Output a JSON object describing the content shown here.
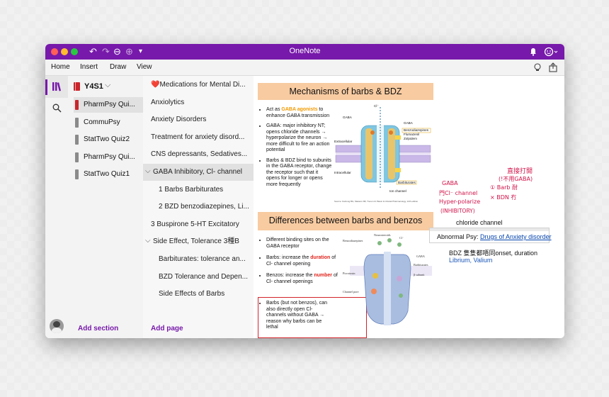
{
  "app": {
    "title": "OneNote"
  },
  "toolbar": {
    "undo": "↶",
    "redo": "↷",
    "back": "⊖",
    "forward": "⊕",
    "more": "▾"
  },
  "menu": {
    "home": "Home",
    "insert": "Insert",
    "draw": "Draw",
    "view": "View"
  },
  "notebook": {
    "name": "Y4S1",
    "chevron": "⌵"
  },
  "sections": [
    {
      "label": "PharmPsy Qui...",
      "color": "#c9252c",
      "selected": true
    },
    {
      "label": "CommuPsy",
      "color": "#8a8a8a"
    },
    {
      "label": "StatTwo Quiz2",
      "color": "#8a8a8a"
    },
    {
      "label": "PharmPsy Qui...",
      "color": "#8a8a8a"
    },
    {
      "label": "StatTwo Quiz1",
      "color": "#8a8a8a"
    }
  ],
  "add_section": "Add section",
  "add_page": "Add page",
  "pages": [
    {
      "label": "❤️Medications for Mental Di...",
      "indent": 0
    },
    {
      "label": "Anxiolytics",
      "indent": 0
    },
    {
      "label": "Anxiety Disorders",
      "indent": 0
    },
    {
      "label": "Treatment for anxiety disord...",
      "indent": 0
    },
    {
      "label": "CNS depressants, Sedatives...",
      "indent": 0
    },
    {
      "label": "GABA Inhibitory, Cl- channel",
      "indent": 0,
      "chevron": "⌵",
      "selected": true
    },
    {
      "label": "1 Barbs Barbiturates",
      "indent": 1
    },
    {
      "label": "2 BZD benzodiazepines, Li...",
      "indent": 1
    },
    {
      "label": "3 Buspirone 5-HT Excitatory",
      "indent": 0
    },
    {
      "label": "Side Effect, Tolerance 3種B",
      "indent": 0,
      "chevron": "⌵"
    },
    {
      "label": "Barbiturates: tolerance an...",
      "indent": 1
    },
    {
      "label": "BZD Tolerance and Depen...",
      "indent": 1
    },
    {
      "label": "Side Effects of Barbs",
      "indent": 1
    }
  ],
  "slide1": {
    "title": "Mechanisms of barbs & BDZ",
    "b1_pre": "Act as ",
    "b1_hl": "GABA agonists",
    "b1_post": " to enhance GABA transmission",
    "b2": "GABA: major inhibitory NT; opens chloride channels → hyperpolarize the neuron → more difficult to fire an action potential",
    "b3": "Barbs & BDZ bind to subunits in the GABA receptor, change the receptor such that it opens for longer or opens more frequently",
    "diagram": {
      "gaba": "GABA",
      "cl": "Cl⁻",
      "gaba2": "GABA",
      "benzo": "Benzodiazepines",
      "flumazenil": "Flumazenil",
      "zolpidem": "Zolpidem",
      "extracellular": "Extracellular",
      "intracellular": "Intracellular",
      "barbiturates": "Barbiturates",
      "ion_channel": "Ion channel",
      "source": "Source: Katzung BG, Masters SB, Trevor AJ: Basic & Clinical Pharmacology, 12th edition"
    }
  },
  "slide2": {
    "title": "Differences between barbs and benzos",
    "b1": "Different binding sites on the GABA receptor",
    "b2_pre": "Barbs: increase the ",
    "b2_hl": "duration",
    "b2_post": " of Cl- channel opening",
    "b3_pre": "Benzos: increase the ",
    "b3_hl": "number",
    "b3_post": " of Cl- channel openings",
    "b4": "Barbs (but not benzos), can also directly open Cl- channels without GABA → reason why barbs can be lethal",
    "diagram": {
      "neurosteroids": "Neurosteroids",
      "benzodiazepines": "Benzodiazepines",
      "cl": "Cl⁻",
      "gaba": "GABA",
      "barbiturates": "Barbiturates",
      "picrotoxin": "Picrotoxin",
      "ethanol": "β subunit",
      "channel": "Channel pore"
    }
  },
  "ink": {
    "line1": "直接打開",
    "line2": "(!不用GABA)",
    "gaba": "GABA",
    "open_cl": "門Cl⁻ channel",
    "barb": "① Barb 耐",
    "bdn": "× BDN 冇",
    "hyper": "Hyper-polarize",
    "inhib": "(INHIBITORY)"
  },
  "notes": {
    "chloride": "chloride channel",
    "abnormal_prefix": "Abnormal Psy: ",
    "abnormal_link": "Drugs of Anxiety disorder",
    "bdz": "BDZ 隻隻都唔同onset, duration",
    "brands": "Librium, Valium"
  },
  "colors": {
    "purple": "#7719aa",
    "accent": "#7719aa",
    "link": "#0645ad"
  }
}
